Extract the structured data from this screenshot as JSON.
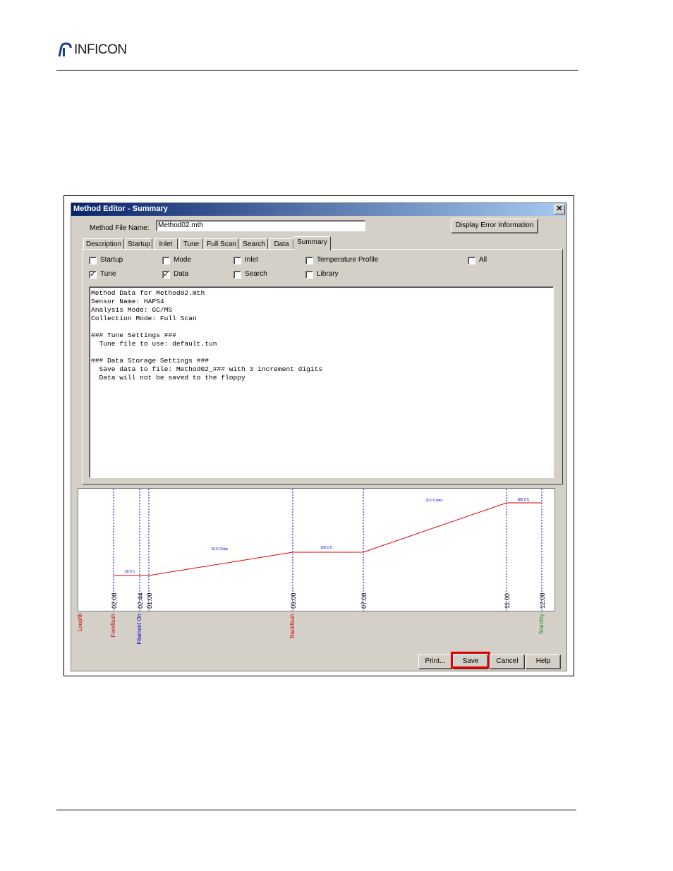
{
  "header": {
    "logo_text": "INFICON"
  },
  "dialog": {
    "title": "Method Editor - Summary",
    "close_label": "✕",
    "file_name_label": "Method File Name:",
    "file_name_value": "Method02.mth",
    "error_button": "Display Error Information",
    "tabs": [
      "Description",
      "Startup",
      "Inlet",
      "Tune",
      "Full Scan",
      "Search",
      "Data",
      "Summary"
    ],
    "active_tab": "Summary",
    "checkboxes": [
      {
        "label": "Startup",
        "checked": false
      },
      {
        "label": "Mode",
        "checked": false
      },
      {
        "label": "Inlet",
        "checked": false
      },
      {
        "label": "Temperature Profile",
        "checked": false
      },
      {
        "label": "All",
        "checked": false
      },
      {
        "label": "Tune",
        "checked": true
      },
      {
        "label": "Data",
        "checked": true
      },
      {
        "label": "Search",
        "checked": false
      },
      {
        "label": "Library",
        "checked": false
      }
    ],
    "summary_lines": [
      "Method Data for Method02.mth",
      "Sensor Name: HAPS4",
      "Analysis Mode: GC/MS",
      "Collection Mode: Full Scan",
      "",
      "### Tune Settings ###",
      "  Tune file to use: default.tun",
      "",
      "### Data Storage Settings ###",
      "  Save data to file: Method02_### with 3 increment digits",
      "  Data will not be saved to the floppy"
    ],
    "buttons": {
      "print": "Print...",
      "save": "Save",
      "cancel": "Cancel",
      "help": "Help"
    }
  },
  "chart_data": {
    "type": "line",
    "colors": {
      "temp": "#e00000",
      "event_blue": "#0000cc",
      "event_red": "#cc0000",
      "event_green": "#2e8b2e"
    },
    "events": [
      {
        "time": "02:00",
        "label": "Foreflush",
        "color": "red"
      },
      {
        "time": "02:44",
        "label": "Filament On",
        "color": "blue"
      },
      {
        "time": "01:00",
        "label": "",
        "color": "blue"
      },
      {
        "time": "05:00",
        "label": "Backflush",
        "color": "red"
      },
      {
        "time": "07:00",
        "label": "",
        "color": "blue"
      },
      {
        "time": "11:00",
        "label": "",
        "color": "blue"
      },
      {
        "time": "12:00",
        "label": "Standby",
        "color": "green"
      }
    ],
    "lead_label": "Loopfill",
    "temp_labels": [
      "50.0 C",
      "10.0 C/min",
      "100.0 C",
      "20.0 C/min",
      "180.0 C"
    ]
  }
}
